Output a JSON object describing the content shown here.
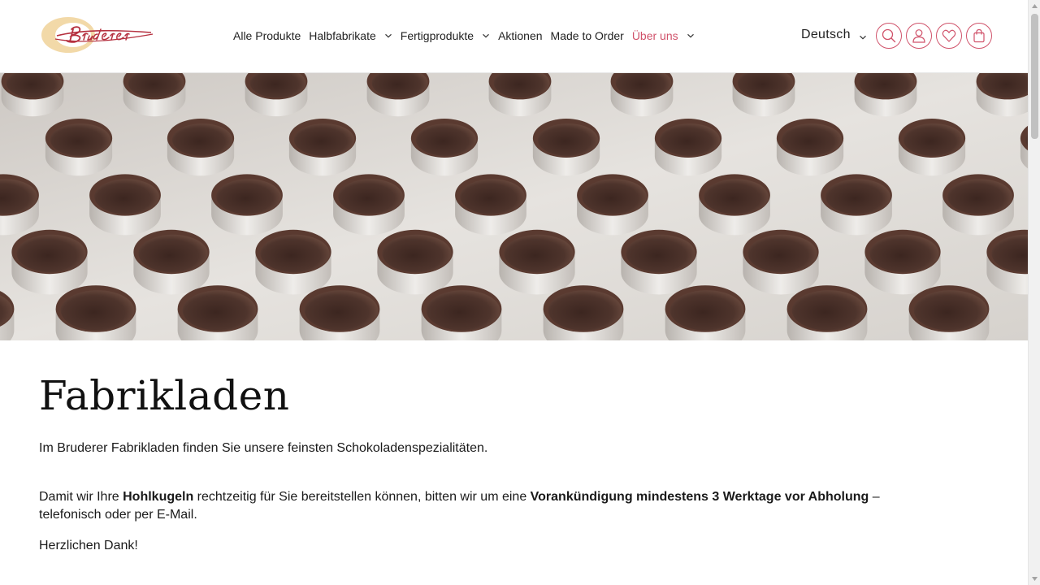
{
  "brand": {
    "logo_text": "Bruderer",
    "accent_color": "#d0526a",
    "logo_disc_color": "#f2d9a8"
  },
  "nav": {
    "items": [
      {
        "label": "Alle Produkte",
        "has_dropdown": false,
        "active": false
      },
      {
        "label": "Halbfabrikate",
        "has_dropdown": true,
        "active": false
      },
      {
        "label": "Fertigprodukte",
        "has_dropdown": true,
        "active": false
      },
      {
        "label": "Aktionen",
        "has_dropdown": false,
        "active": false
      },
      {
        "label": "Made to Order",
        "has_dropdown": false,
        "active": false
      },
      {
        "label": "Über uns",
        "has_dropdown": true,
        "active": true
      }
    ]
  },
  "header": {
    "language": "Deutsch",
    "icons": [
      "search-icon",
      "user-icon",
      "heart-icon",
      "shopping-bag-icon"
    ]
  },
  "hero": {
    "image": "rows of chocolate hollow shells"
  },
  "content": {
    "title": "Fabrikladen",
    "p1": "Im Bruderer Fabrikladen finden Sie unsere feinsten Schokoladenspezialitäten.",
    "p2_a": "Damit wir Ihre ",
    "p2_b": "Hohlkugeln",
    "p2_c": " rechtzeitig für Sie bereitstellen können, bitten wir um eine ",
    "p2_d": "Vorankündigung mindestens 3 Werktage vor Abholung",
    "p2_e": " – telefonisch oder per E-Mail.",
    "p3": "Herzlichen Dank!"
  }
}
